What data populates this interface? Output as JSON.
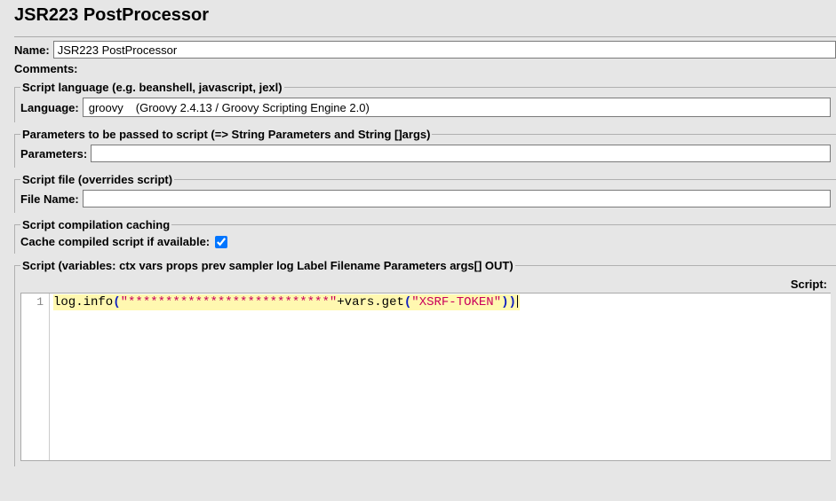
{
  "title": "JSR223 PostProcessor",
  "nameRow": {
    "label": "Name:",
    "value": "JSR223 PostProcessor"
  },
  "commentsRow": {
    "label": "Comments:",
    "value": ""
  },
  "langSection": {
    "legend": "Script language (e.g. beanshell, javascript, jexl)",
    "label": "Language:",
    "selectedName": "groovy",
    "selectedDesc": "(Groovy 2.4.13 / Groovy Scripting Engine 2.0)"
  },
  "paramsSection": {
    "legend": "Parameters to be passed to script (=> String Parameters and String []args)",
    "label": "Parameters:",
    "value": ""
  },
  "fileSection": {
    "legend": "Script file (overrides script)",
    "label": "File Name:",
    "value": ""
  },
  "cacheSection": {
    "legend": "Script compilation caching",
    "label": "Cache compiled script if available:",
    "checked": true
  },
  "scriptSection": {
    "legend": "Script (variables: ctx vars props prev sampler log Label Filename Parameters args[] OUT)",
    "scriptLabel": "Script:",
    "gutter": "1",
    "code": {
      "p1": "log.info",
      "p2": "(",
      "p3": "\"***************************\"",
      "p4": "+vars.get",
      "p5": "(",
      "p6": "\"XSRF-TOKEN\"",
      "p7": ")",
      "p8": ")"
    }
  }
}
